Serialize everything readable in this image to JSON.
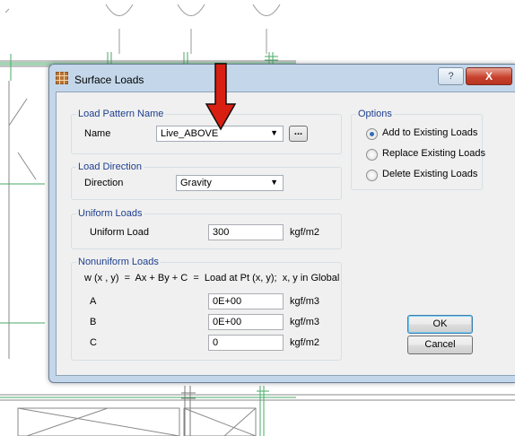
{
  "dialog": {
    "title": "Surface Loads",
    "help_label": "?",
    "close_label": "X"
  },
  "load_pattern": {
    "legend": "Load Pattern Name",
    "name_label": "Name",
    "name_value": "Live_ABOVE",
    "browse_label": "..."
  },
  "load_direction": {
    "legend": "Load Direction",
    "direction_label": "Direction",
    "direction_value": "Gravity"
  },
  "uniform_loads": {
    "legend": "Uniform Loads",
    "load_label": "Uniform Load",
    "load_value": "300",
    "load_unit": "kgf/m2"
  },
  "nonuniform_loads": {
    "legend": "Nonuniform Loads",
    "formula": "w (x , y)  =  Ax + By + C  =  Load at Pt (x, y);  x, y in Global",
    "rows": [
      {
        "label": "A",
        "value": "0E+00",
        "unit": "kgf/m3"
      },
      {
        "label": "B",
        "value": "0E+00",
        "unit": "kgf/m3"
      },
      {
        "label": "C",
        "value": "0",
        "unit": "kgf/m2"
      }
    ]
  },
  "options": {
    "legend": "Options",
    "items": [
      {
        "label": "Add to Existing Loads",
        "checked": true
      },
      {
        "label": "Replace Existing Loads",
        "checked": false
      },
      {
        "label": "Delete Existing Loads",
        "checked": false
      }
    ]
  },
  "buttons": {
    "ok_label": "OK",
    "cancel_label": "Cancel"
  },
  "colors": {
    "annotation_arrow": "#d91f12",
    "drawing_lines": "#8a8a8a",
    "grid_lines": "#4aa86a"
  }
}
